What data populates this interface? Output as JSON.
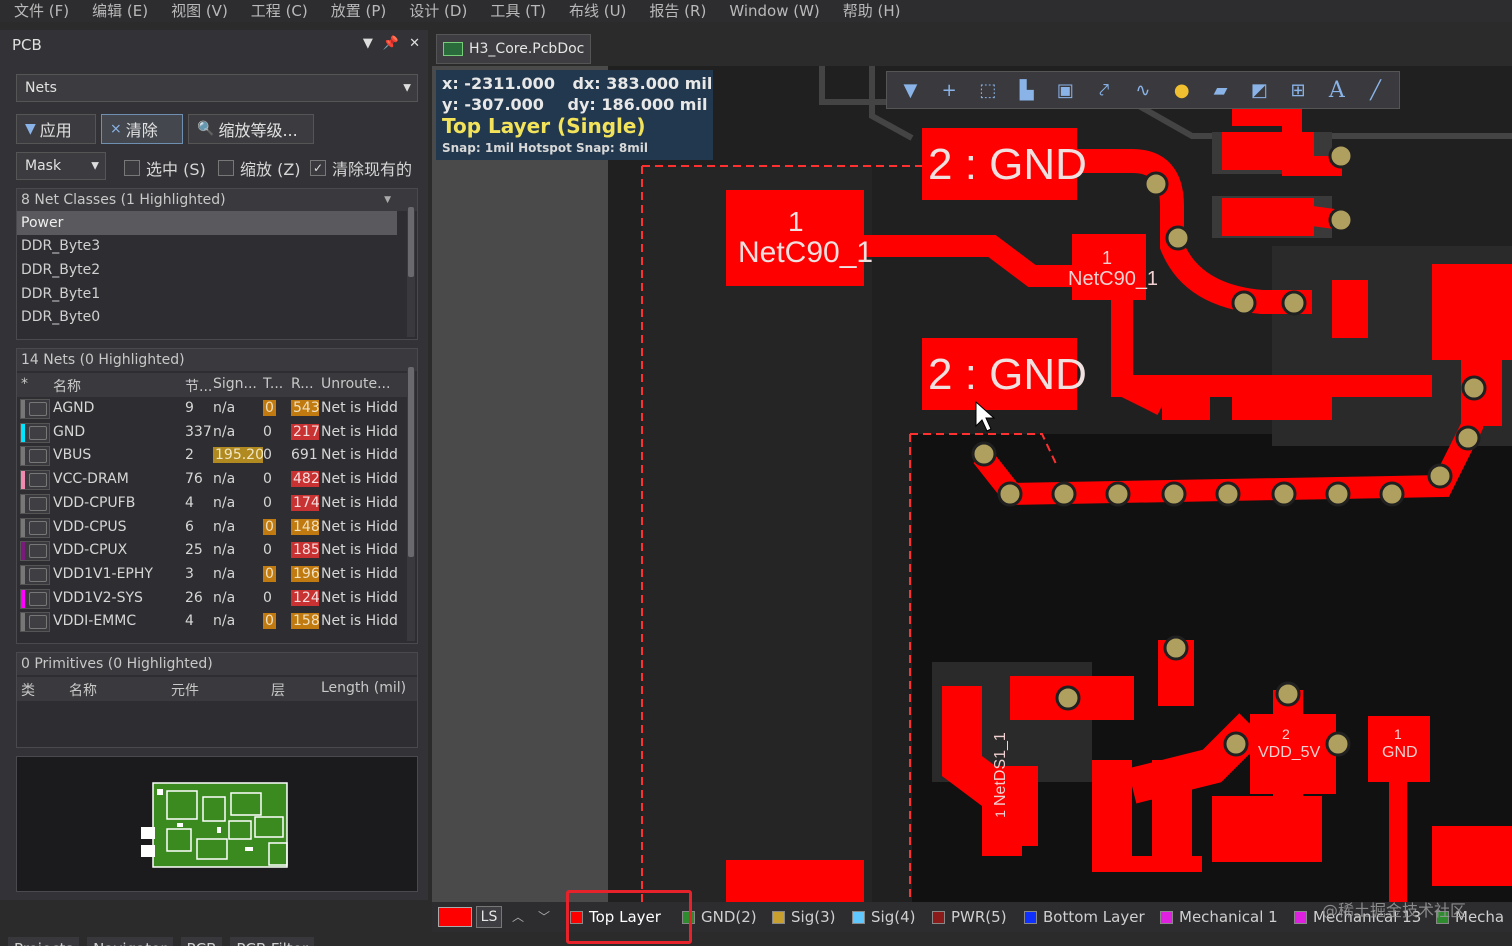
{
  "menu": [
    "文件 (F)",
    "编辑 (E)",
    "视图 (V)",
    "工程 (C)",
    "放置 (P)",
    "设计 (D)",
    "工具 (T)",
    "布线 (U)",
    "报告 (R)",
    "Window (W)",
    "帮助 (H)"
  ],
  "panel": {
    "title": "PCB",
    "mode": "Nets",
    "buttons": {
      "apply": "应用",
      "clear": "清除",
      "zoom": "缩放等级..."
    },
    "mask": "Mask",
    "checks": {
      "select": "选中 (S)",
      "zoom": "缩放 (Z)",
      "clear_existing": "清除现有的"
    },
    "classes_header": "8 Net Classes (1 Highlighted)",
    "classes": [
      "Power",
      "DDR_Byte3",
      "DDR_Byte2",
      "DDR_Byte1",
      "DDR_Byte0"
    ],
    "nets_header": "14 Nets (0 Highlighted)",
    "net_columns": [
      "*",
      "名称",
      "节...",
      "Sign...",
      "T...",
      "R...",
      "Unroute..."
    ],
    "nets": [
      {
        "name": "AGND",
        "nodes": "9",
        "sign": "n/a",
        "t": "0",
        "r": "543",
        "unrouted": "Net is Hidd",
        "color": "#777777",
        "t_hl": "o",
        "r_hl": "o"
      },
      {
        "name": "GND",
        "nodes": "337",
        "sign": "n/a",
        "t": "0",
        "r": "217",
        "unrouted": "Net is Hidd",
        "color": "#00e5ff",
        "t_hl": "",
        "r_hl": "r"
      },
      {
        "name": "VBUS",
        "nodes": "2",
        "sign": "195.20",
        "t": "0",
        "r": "691",
        "unrouted": "Net is Hidd",
        "color": "#777777",
        "t_hl": "",
        "r_hl": "",
        "sign_hl": "y"
      },
      {
        "name": "VCC-DRAM",
        "nodes": "76",
        "sign": "n/a",
        "t": "0",
        "r": "482",
        "unrouted": "Net is Hidd",
        "color": "#f08ab0",
        "t_hl": "",
        "r_hl": "r"
      },
      {
        "name": "VDD-CPUFB",
        "nodes": "4",
        "sign": "n/a",
        "t": "0",
        "r": "174",
        "unrouted": "Net is Hidd",
        "color": "#777777",
        "t_hl": "",
        "r_hl": "r"
      },
      {
        "name": "VDD-CPUS",
        "nodes": "6",
        "sign": "n/a",
        "t": "0",
        "r": "148",
        "unrouted": "Net is Hidd",
        "color": "#777777",
        "t_hl": "o",
        "r_hl": "o"
      },
      {
        "name": "VDD-CPUX",
        "nodes": "25",
        "sign": "n/a",
        "t": "0",
        "r": "185",
        "unrouted": "Net is Hidd",
        "color": "#7a1a7a",
        "t_hl": "",
        "r_hl": "r"
      },
      {
        "name": "VDD1V1-EPHY",
        "nodes": "3",
        "sign": "n/a",
        "t": "0",
        "r": "196",
        "unrouted": "Net is Hidd",
        "color": "#777777",
        "t_hl": "o",
        "r_hl": "o"
      },
      {
        "name": "VDD1V2-SYS",
        "nodes": "26",
        "sign": "n/a",
        "t": "0",
        "r": "124",
        "unrouted": "Net is Hidd",
        "color": "#ff00ff",
        "t_hl": "",
        "r_hl": "r"
      },
      {
        "name": "VDDI-EMMC",
        "nodes": "4",
        "sign": "n/a",
        "t": "0",
        "r": "158",
        "unrouted": "Net is Hidd",
        "color": "#777777",
        "t_hl": "o",
        "r_hl": "o"
      }
    ],
    "prims_header": "0 Primitives (0 Highlighted)",
    "prim_columns": [
      "类",
      "名称",
      "元件",
      "层",
      "Length (mil)"
    ],
    "tabs": [
      "Projects",
      "Navigator",
      "PCB",
      "PCB Filter"
    ]
  },
  "document": {
    "tab": "H3_Core.PcbDoc"
  },
  "coords": {
    "x_label": "x:",
    "x": "-2311.000",
    "dx_label": "dx:",
    "dx": "383.000 mil",
    "y_label": "y:",
    "y": "-307.000",
    "dy_label": "dy:",
    "dy": "186.000 mil",
    "layer": "Top Layer (Single)",
    "snap": "Snap: 1mil Hotspot Snap: 8mil"
  },
  "pcb": {
    "pad_gnd_1": "2 : GND",
    "pad_gnd_2": "2 : GND",
    "pad_netc90_1": "1",
    "pad_netc90_name": "NetC90_1",
    "pad_netc90_b_1": "1",
    "pad_netc90_b_name": "NetC90_1",
    "pad_vdd5v_1": "2",
    "pad_vdd5v_name": "VDD_5V",
    "pad_gnd_s_1": "1",
    "pad_gnd_s_name": "GND",
    "pad_netds1": "1",
    "pad_netds1_name": "NetDS1_1",
    "copper_color": "#ff0000",
    "via_color": "#b0a060"
  },
  "layerbar": {
    "ls": "LS",
    "layers": [
      {
        "name": "Top Layer",
        "color": "#ff0000"
      },
      {
        "name": "GND(2)",
        "color": "#2e8b2e"
      },
      {
        "name": "Sig(3)",
        "color": "#c8a030"
      },
      {
        "name": "Sig(4)",
        "color": "#60c8ff"
      },
      {
        "name": "PWR(5)",
        "color": "#8b1a1a"
      },
      {
        "name": "Bottom Layer",
        "color": "#1030ff"
      },
      {
        "name": "Mechanical 1",
        "color": "#e020e0"
      },
      {
        "name": "Mechanical 13",
        "color": "#e020e0"
      },
      {
        "name": "Mecha",
        "color": "#2e8b2e"
      }
    ]
  },
  "watermark": "@稀土掘金技术社区"
}
